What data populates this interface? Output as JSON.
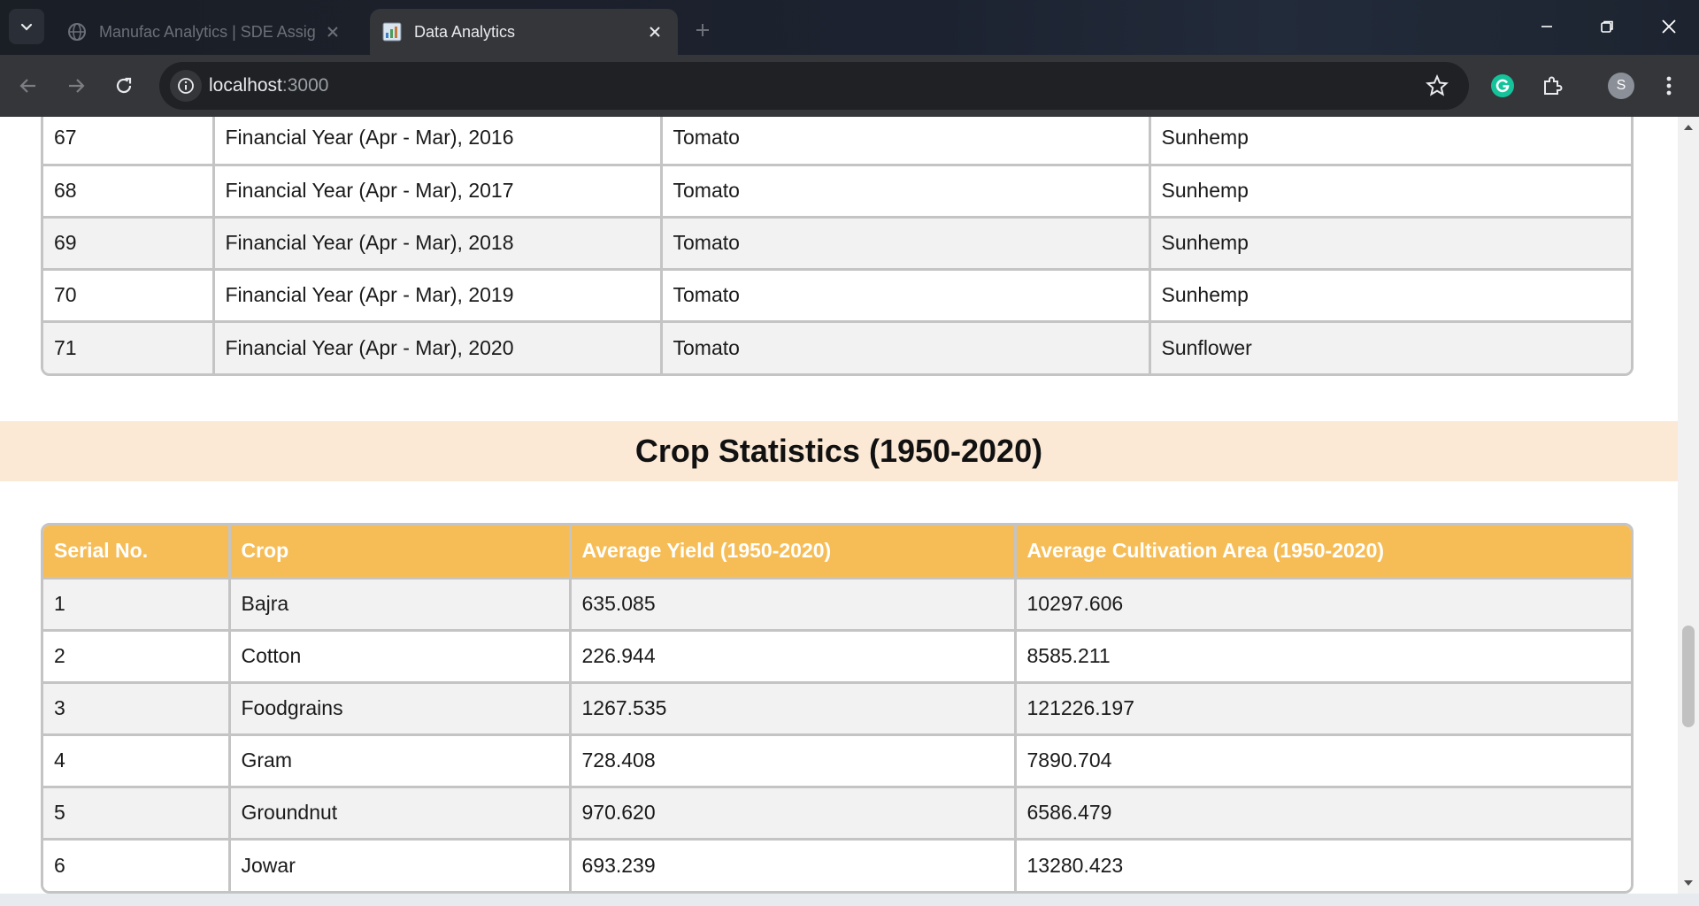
{
  "browser": {
    "tabs": [
      {
        "title": "Manufac Analytics | SDE Assign",
        "active": false,
        "favicon": "globe-icon"
      },
      {
        "title": "Data Analytics",
        "active": true,
        "favicon": "chart-favicon-icon"
      }
    ],
    "url_host": "localhost",
    "url_port": ":3000",
    "profile_initial": "S"
  },
  "table1": {
    "rows": [
      {
        "serial": "67",
        "year": "Financial Year (Apr - Mar), 2016",
        "max_crop": "Tomato",
        "min_crop": "Sunhemp"
      },
      {
        "serial": "68",
        "year": "Financial Year (Apr - Mar), 2017",
        "max_crop": "Tomato",
        "min_crop": "Sunhemp"
      },
      {
        "serial": "69",
        "year": "Financial Year (Apr - Mar), 2018",
        "max_crop": "Tomato",
        "min_crop": "Sunhemp"
      },
      {
        "serial": "70",
        "year": "Financial Year (Apr - Mar), 2019",
        "max_crop": "Tomato",
        "min_crop": "Sunhemp"
      },
      {
        "serial": "71",
        "year": "Financial Year (Apr - Mar), 2020",
        "max_crop": "Tomato",
        "min_crop": "Sunflower"
      }
    ]
  },
  "section2": {
    "title": "Crop Statistics (1950-2020)",
    "headers": [
      "Serial No.",
      "Crop",
      "Average Yield (1950-2020)",
      "Average Cultivation Area (1950-2020)"
    ],
    "rows": [
      {
        "serial": "1",
        "crop": "Bajra",
        "avg_yield": "635.085",
        "avg_area": "10297.606"
      },
      {
        "serial": "2",
        "crop": "Cotton",
        "avg_yield": "226.944",
        "avg_area": "8585.211"
      },
      {
        "serial": "3",
        "crop": "Foodgrains",
        "avg_yield": "1267.535",
        "avg_area": "121226.197"
      },
      {
        "serial": "4",
        "crop": "Gram",
        "avg_yield": "728.408",
        "avg_area": "7890.704"
      },
      {
        "serial": "5",
        "crop": "Groundnut",
        "avg_yield": "970.620",
        "avg_area": "6586.479"
      },
      {
        "serial": "6",
        "crop": "Jowar",
        "avg_yield": "693.239",
        "avg_area": "13280.423"
      }
    ]
  },
  "colors": {
    "header_bg": "#f6bd57",
    "band_bg": "#fbe9d6",
    "row_odd": "#f2f2f2",
    "row_even": "#ffffff",
    "border": "#c4c4c4"
  }
}
